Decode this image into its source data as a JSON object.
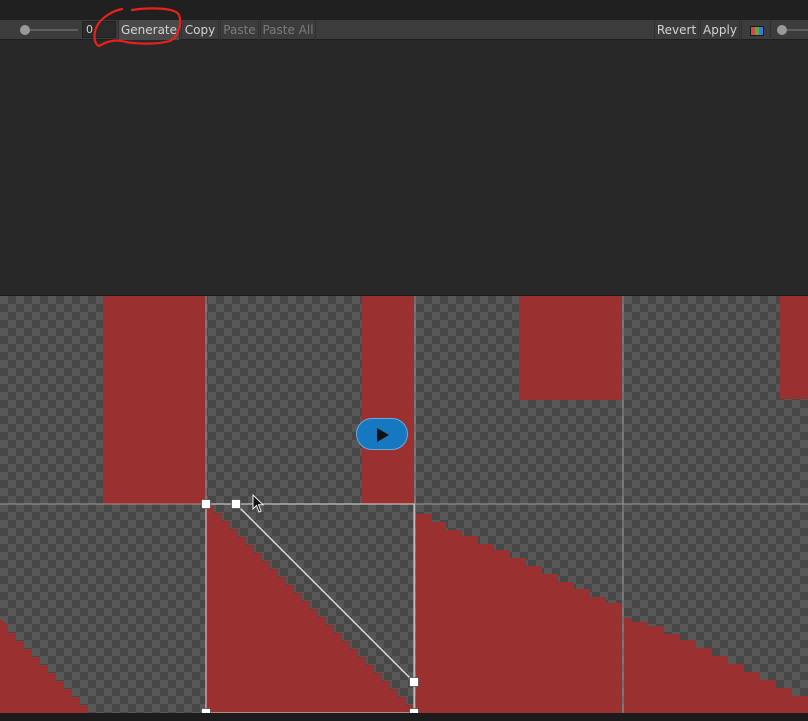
{
  "toolbar": {
    "frame_value": "0",
    "buttons": [
      {
        "label": "Generate",
        "enabled": true
      },
      {
        "label": "Copy",
        "enabled": true
      },
      {
        "label": "Paste",
        "enabled": false
      },
      {
        "label": "Paste All",
        "enabled": false
      },
      {
        "label": "Revert",
        "enabled": true
      },
      {
        "label": "Apply",
        "enabled": true
      }
    ]
  },
  "icons": {
    "color_channels": "rgb-channels-icon",
    "play": "play-icon",
    "cursor": "mouse-pointer-icon"
  },
  "colors": {
    "sprite_fill": "#9a3030",
    "annotation": "#e8211c",
    "play_button": "#1778c2",
    "selection_outline": "#dddddd"
  }
}
